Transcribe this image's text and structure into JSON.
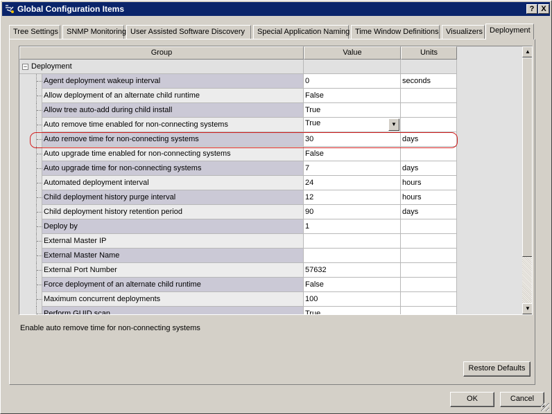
{
  "window": {
    "title": "Global Configuration Items",
    "help_label": "?",
    "close_label": "X"
  },
  "tabs": [
    {
      "label": "Tree Settings"
    },
    {
      "label": "SNMP Monitoring"
    },
    {
      "label": "User Assisted Software Discovery"
    },
    {
      "label": "Special Application Naming"
    },
    {
      "label": "Time Window Definitions"
    },
    {
      "label": "Visualizers"
    },
    {
      "label": "Deployment",
      "active": true
    }
  ],
  "grid": {
    "columns": {
      "group": "Group",
      "value": "Value",
      "units": "Units"
    },
    "group_expander": "−",
    "group_name": "Deployment",
    "rows": [
      {
        "name": "Agent deployment wakeup interval",
        "value": "0",
        "units": "seconds"
      },
      {
        "name": "Allow deployment of an alternate child runtime",
        "value": "False",
        "units": ""
      },
      {
        "name": "Allow tree auto-add during child install",
        "value": "True",
        "units": ""
      },
      {
        "name": "Auto remove time enabled for non-connecting systems",
        "value": "True",
        "units": ""
      },
      {
        "name": "Auto remove time for non-connecting systems",
        "value": "30",
        "units": "days"
      },
      {
        "name": "Auto upgrade time enabled for non-connecting systems",
        "value": "False",
        "units": ""
      },
      {
        "name": "Auto upgrade time for non-connecting systems",
        "value": "7",
        "units": "days"
      },
      {
        "name": "Automated deployment interval",
        "value": "24",
        "units": "hours"
      },
      {
        "name": "Child deployment history purge interval",
        "value": "12",
        "units": "hours"
      },
      {
        "name": "Child deployment history retention period",
        "value": "90",
        "units": "days"
      },
      {
        "name": "Deploy by",
        "value": "1",
        "units": ""
      },
      {
        "name": "External Master IP",
        "value": "",
        "units": ""
      },
      {
        "name": "External Master Name",
        "value": "",
        "units": ""
      },
      {
        "name": "External Port Number",
        "value": "57632",
        "units": ""
      },
      {
        "name": "Force deployment of an alternate child runtime",
        "value": "False",
        "units": ""
      },
      {
        "name": "Maximum concurrent deployments",
        "value": "100",
        "units": ""
      },
      {
        "name": "Perform GUID scan",
        "value": "True",
        "units": ""
      }
    ]
  },
  "description": "Enable auto remove time for non-connecting systems",
  "buttons": {
    "restore_defaults": "Restore Defaults",
    "ok": "OK",
    "cancel": "Cancel"
  },
  "colors": {
    "titlebar": "#0a246a",
    "highlight": "#d21f1f",
    "name_cell": "#cbc9d6"
  }
}
